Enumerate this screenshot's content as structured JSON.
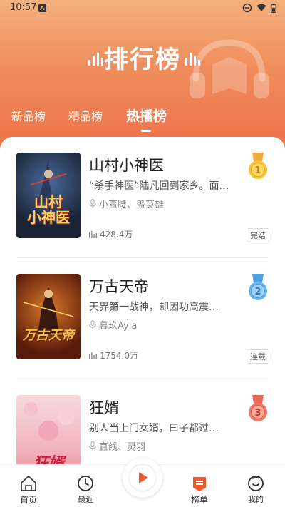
{
  "status_bar": {
    "time": "10:57",
    "a_badge": "A"
  },
  "header": {
    "title": "排行榜"
  },
  "tabs": [
    {
      "label": "新品榜",
      "active": false
    },
    {
      "label": "精品榜",
      "active": false
    },
    {
      "label": "热播榜",
      "active": true
    }
  ],
  "books": [
    {
      "title": "山村小神医",
      "description": "“杀手神医”陆凡回到家乡。面…",
      "authors": "小蛮腰、盖英雄",
      "plays": "428.4万",
      "status": "完结",
      "rank": "1",
      "cover_text": "山村小神医",
      "cover_text_line1": "山村",
      "cover_text_line2": "小神医"
    },
    {
      "title": "万古天帝",
      "description": "天界第一战神，却因功高震…",
      "authors": "暮玖Ayla",
      "plays": "1754.0万",
      "status": "连载",
      "rank": "2",
      "cover_text": "万古天帝"
    },
    {
      "title": "狂婿",
      "description": "别人当上门女婿，曰子都过…",
      "authors": "直线、灵羽",
      "rank": "3",
      "cover_text": "狂婿"
    }
  ],
  "nav": [
    {
      "label": "首页",
      "icon": "home-icon"
    },
    {
      "label": "最近",
      "icon": "clock-icon"
    },
    {
      "label": "",
      "icon": "play-icon"
    },
    {
      "label": "榜单",
      "icon": "ranking-icon"
    },
    {
      "label": "我的",
      "icon": "profile-icon"
    }
  ],
  "colors": {
    "header_top": "#f3b07c",
    "header_bottom": "#ee7048",
    "accent": "#ef5a2c",
    "gold": "#f5c33b",
    "blue": "#6ab4f0",
    "red": "#ef7a6b"
  }
}
